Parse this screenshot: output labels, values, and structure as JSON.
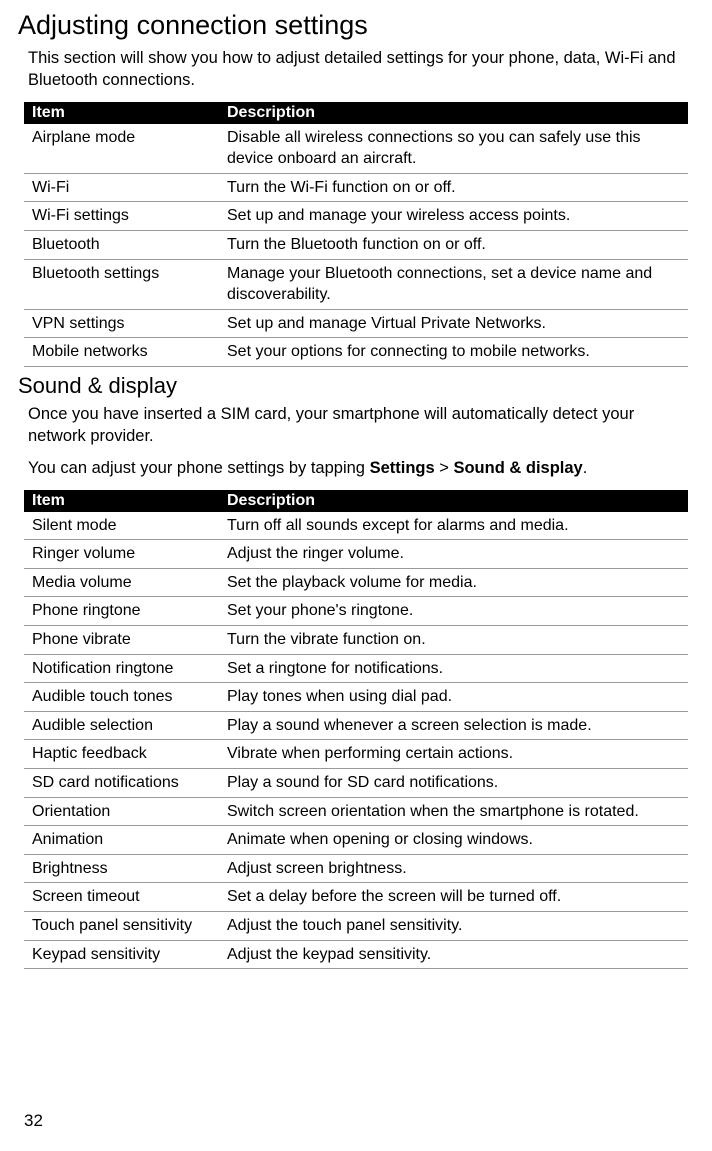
{
  "section1": {
    "heading": "Adjusting connection settings",
    "intro": "This section will show you how to adjust detailed settings for your phone, data, Wi-Fi and Bluetooth connections.",
    "table_headers": {
      "item": "Item",
      "description": "Description"
    },
    "rows": [
      {
        "item": "Airplane mode",
        "description": "Disable all wireless connections so you can safely use this device onboard an aircraft."
      },
      {
        "item": "Wi-Fi",
        "description": "Turn the Wi-Fi function on or off."
      },
      {
        "item": "Wi-Fi settings",
        "description": "Set up and manage your wireless access points."
      },
      {
        "item": "Bluetooth",
        "description": "Turn the Bluetooth function on or off."
      },
      {
        "item": "Bluetooth settings",
        "description": "Manage your Bluetooth connections, set a device name and discoverability."
      },
      {
        "item": "VPN settings",
        "description": "Set up and manage Virtual Private Networks."
      },
      {
        "item": "Mobile networks",
        "description": "Set your options for connecting to mobile networks."
      }
    ]
  },
  "section2": {
    "heading": "Sound & display",
    "intro1": "Once you have inserted a SIM card, your smartphone will automatically detect your network provider.",
    "intro2_prefix": "You can adjust your phone settings by tapping ",
    "intro2_bold1": "Settings",
    "intro2_sep": " > ",
    "intro2_bold2": "Sound & display",
    "intro2_suffix": ".",
    "table_headers": {
      "item": "Item",
      "description": "Description"
    },
    "rows": [
      {
        "item": "Silent mode",
        "description": "Turn off all sounds except for alarms and media."
      },
      {
        "item": "Ringer volume",
        "description": "Adjust the ringer volume."
      },
      {
        "item": "Media volume",
        "description": "Set the playback volume for media."
      },
      {
        "item": "Phone ringtone",
        "description": "Set your phone's ringtone."
      },
      {
        "item": "Phone vibrate",
        "description": "Turn the vibrate function on."
      },
      {
        "item": "Notification ringtone",
        "description": "Set a ringtone for notifications."
      },
      {
        "item": "Audible touch tones",
        "description": "Play tones when using dial pad."
      },
      {
        "item": "Audible selection",
        "description": "Play a sound whenever a screen selection is made."
      },
      {
        "item": "Haptic feedback",
        "description": "Vibrate when performing certain actions."
      },
      {
        "item": "SD card notifications",
        "description": "Play a sound for SD card notifications."
      },
      {
        "item": "Orientation",
        "description": "Switch screen orientation when the smartphone is rotated."
      },
      {
        "item": "Animation",
        "description": "Animate when opening or closing windows."
      },
      {
        "item": "Brightness",
        "description": "Adjust screen brightness."
      },
      {
        "item": "Screen timeout",
        "description": "Set a delay before the screen will be turned off."
      },
      {
        "item": "Touch panel sensitivity",
        "description": "Adjust the touch panel sensitivity."
      },
      {
        "item": "Keypad sensitivity",
        "description": "Adjust the keypad sensitivity."
      }
    ]
  },
  "page_number": "32"
}
